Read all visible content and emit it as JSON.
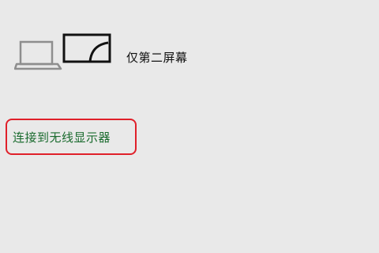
{
  "project_option": {
    "label": "仅第二屏幕",
    "icon": "second-screen-only-icon"
  },
  "wireless_link": {
    "label": "连接到无线显示器",
    "color": "#1a6b2e",
    "highlight_color": "#e0202a"
  },
  "colors": {
    "background": "#e9e9e9"
  }
}
